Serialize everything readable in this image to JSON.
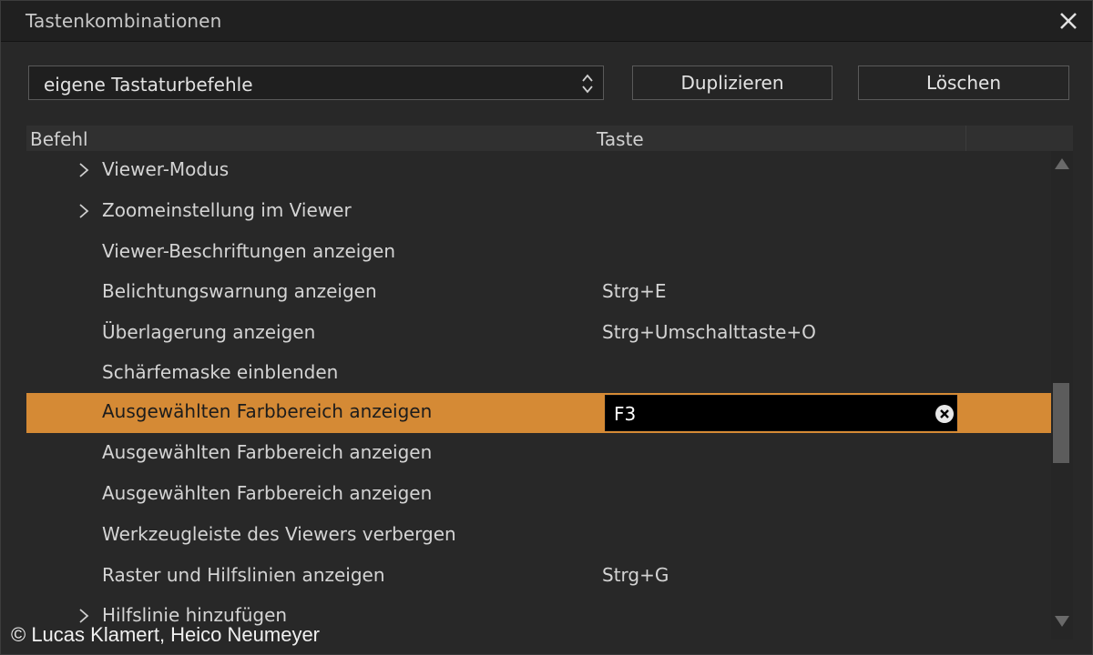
{
  "window": {
    "title": "Tastenkombinationen",
    "close_icon": "close-icon"
  },
  "toolbar": {
    "preset_value": "eigene Tastaturbefehle",
    "duplicate_label": "Duplizieren",
    "delete_label": "Löschen"
  },
  "table": {
    "col_command": "Befehl",
    "col_key": "Taste",
    "rows": [
      {
        "command": "Viewer-Modus",
        "key": "",
        "expandable": true
      },
      {
        "command": "Zoomeinstellung im Viewer",
        "key": "",
        "expandable": true
      },
      {
        "command": "Viewer-Beschriftungen anzeigen",
        "key": ""
      },
      {
        "command": "Belichtungswarnung anzeigen",
        "key": "Strg+E"
      },
      {
        "command": "Überlagerung anzeigen",
        "key": "Strg+Umschalttaste+O"
      },
      {
        "command": "Schärfemaske einblenden",
        "key": ""
      },
      {
        "command": "Ausgewählten Farbbereich anzeigen",
        "key": "F3",
        "selected": true
      },
      {
        "command": "Ausgewählten Farbbereich anzeigen",
        "key": ""
      },
      {
        "command": "Ausgewählten Farbbereich anzeigen",
        "key": ""
      },
      {
        "command": "Werkzeugleiste des Viewers verbergen",
        "key": ""
      },
      {
        "command": "Raster und Hilfslinien anzeigen",
        "key": "Strg+G"
      },
      {
        "command": "Hilfslinie hinzufügen",
        "key": "",
        "expandable": true
      }
    ]
  },
  "colors": {
    "selection": "#d58a35",
    "background": "#282828"
  },
  "copyright": "© Lucas Klamert, Heico Neumeyer"
}
